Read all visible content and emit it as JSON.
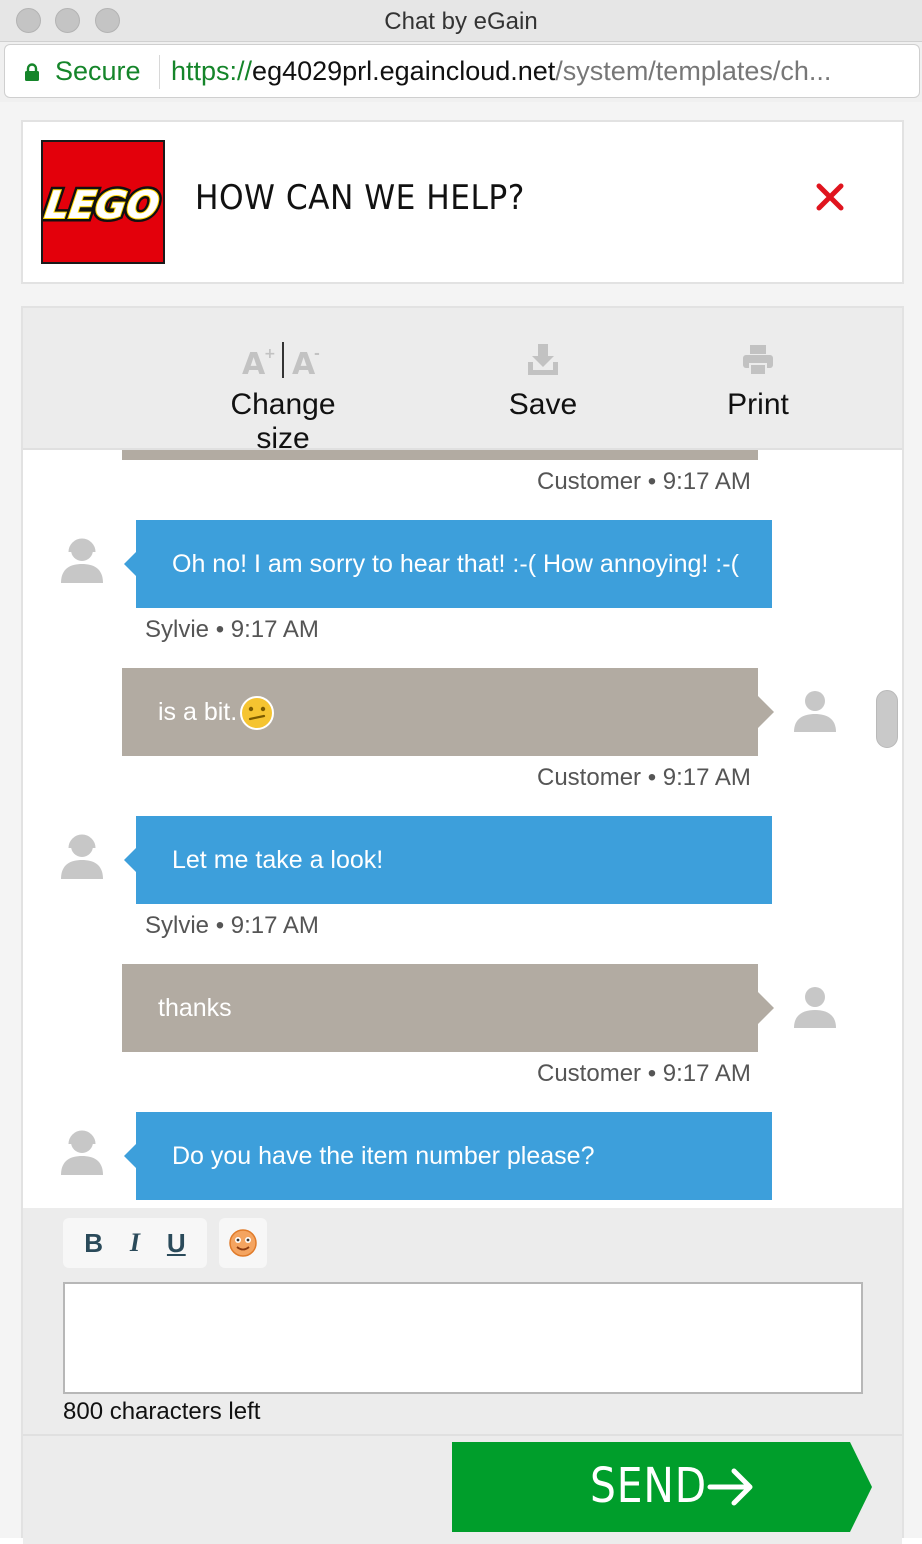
{
  "window": {
    "title": "Chat by eGain"
  },
  "addressbar": {
    "secure_label": "Secure",
    "url_scheme": "https://",
    "url_host": "eg4029prl.egaincloud.net",
    "url_path": "/system/templates/ch..."
  },
  "header": {
    "logo_text": "LEGO",
    "title": "HOW CAN WE HELP?"
  },
  "toolbar": {
    "change_size": "Change size",
    "save": "Save",
    "print": "Print"
  },
  "messages": [
    {
      "meta": "Customer • 9:17 AM"
    },
    {
      "sender": "agent",
      "text": "Oh no! I am sorry to hear that! :-( How annoying! :-(",
      "meta": "Sylvie • 9:17 AM"
    },
    {
      "sender": "customer",
      "text": "is a bit.",
      "meta": "Customer • 9:17 AM",
      "emoji": "confused-emoji"
    },
    {
      "sender": "agent",
      "text": "Let me take a look!",
      "meta": "Sylvie • 9:17 AM"
    },
    {
      "sender": "customer",
      "text": "thanks",
      "meta": "Customer • 9:17 AM"
    },
    {
      "sender": "agent",
      "text": "Do you have the item number please?"
    }
  ],
  "composer": {
    "bold": "B",
    "italic": "I",
    "underline": "U",
    "input_value": "",
    "char_count": "800 characters left"
  },
  "send": {
    "label": "SEND"
  },
  "colors": {
    "agent_bubble": "#3d9fdb",
    "customer_bubble": "#b2aba2",
    "send_green": "#009e2b",
    "secure_green": "#15852a",
    "lego_red": "#e3000b"
  }
}
